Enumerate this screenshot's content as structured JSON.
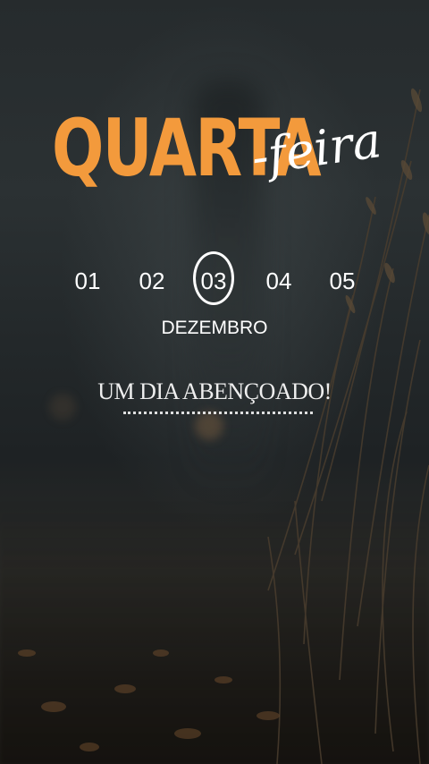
{
  "title": {
    "main": "QUARTA",
    "script": "-feira"
  },
  "days": [
    "01",
    "02",
    "03",
    "04",
    "05"
  ],
  "selected_day": "03",
  "month": "DEZEMBRO",
  "tagline": "UM DIA ABENÇOADO!",
  "colors": {
    "accent": "#f39a3c",
    "text": "#ffffff"
  }
}
